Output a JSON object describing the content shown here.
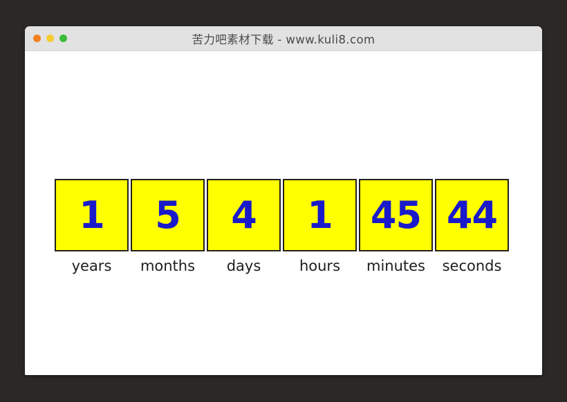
{
  "window": {
    "title": "苦力吧素材下载 - www.kuli8.com",
    "controls": [
      {
        "name": "close",
        "icon": "close-dot-icon",
        "color": "#f4811f"
      },
      {
        "name": "minimize",
        "icon": "minimize-dot-icon",
        "color": "#f6cb2f"
      },
      {
        "name": "maximize",
        "icon": "maximize-dot-icon",
        "color": "#3cbc38"
      }
    ]
  },
  "countdown": {
    "box_color": "#ffff00",
    "value_color": "#1a1acb",
    "border_color": "#221f1c",
    "label_color": "#1d1d1d",
    "units": [
      {
        "value": "1",
        "label": "years"
      },
      {
        "value": "5",
        "label": "months"
      },
      {
        "value": "4",
        "label": "days"
      },
      {
        "value": "1",
        "label": "hours"
      },
      {
        "value": "45",
        "label": "minutes"
      },
      {
        "value": "44",
        "label": "seconds"
      }
    ]
  },
  "page_background": "#2b2826",
  "content_background": "#ffffff"
}
